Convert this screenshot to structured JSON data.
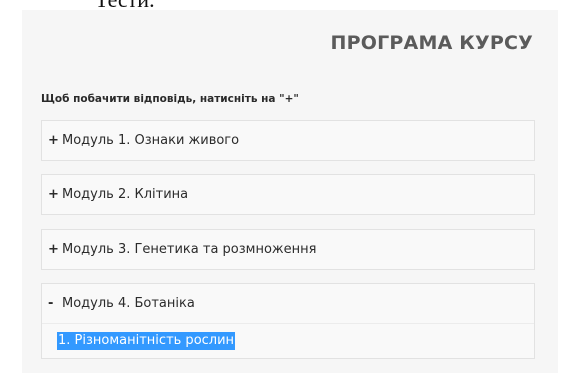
{
  "top_fragment": "Тести.",
  "panel": {
    "title": "ПРОГРАМА КУРСУ",
    "hint": "Щоб побачити відповідь, натисніть на \"+\""
  },
  "modules": [
    {
      "sign": "+",
      "label": "Модуль 1. Ознаки живого"
    },
    {
      "sign": "+",
      "label": "Модуль 2. Клітина"
    },
    {
      "sign": "+",
      "label": "Модуль 3. Генетика та розмноження"
    },
    {
      "sign": "-",
      "label": "Модуль 4. Ботаніка",
      "expanded": true,
      "items": [
        {
          "label": "1. Різноманітність рослин",
          "selected": true
        }
      ]
    }
  ],
  "colors": {
    "selection": "#3399ff",
    "panel_bg": "#f6f6f6",
    "title": "#5b5b5b"
  }
}
